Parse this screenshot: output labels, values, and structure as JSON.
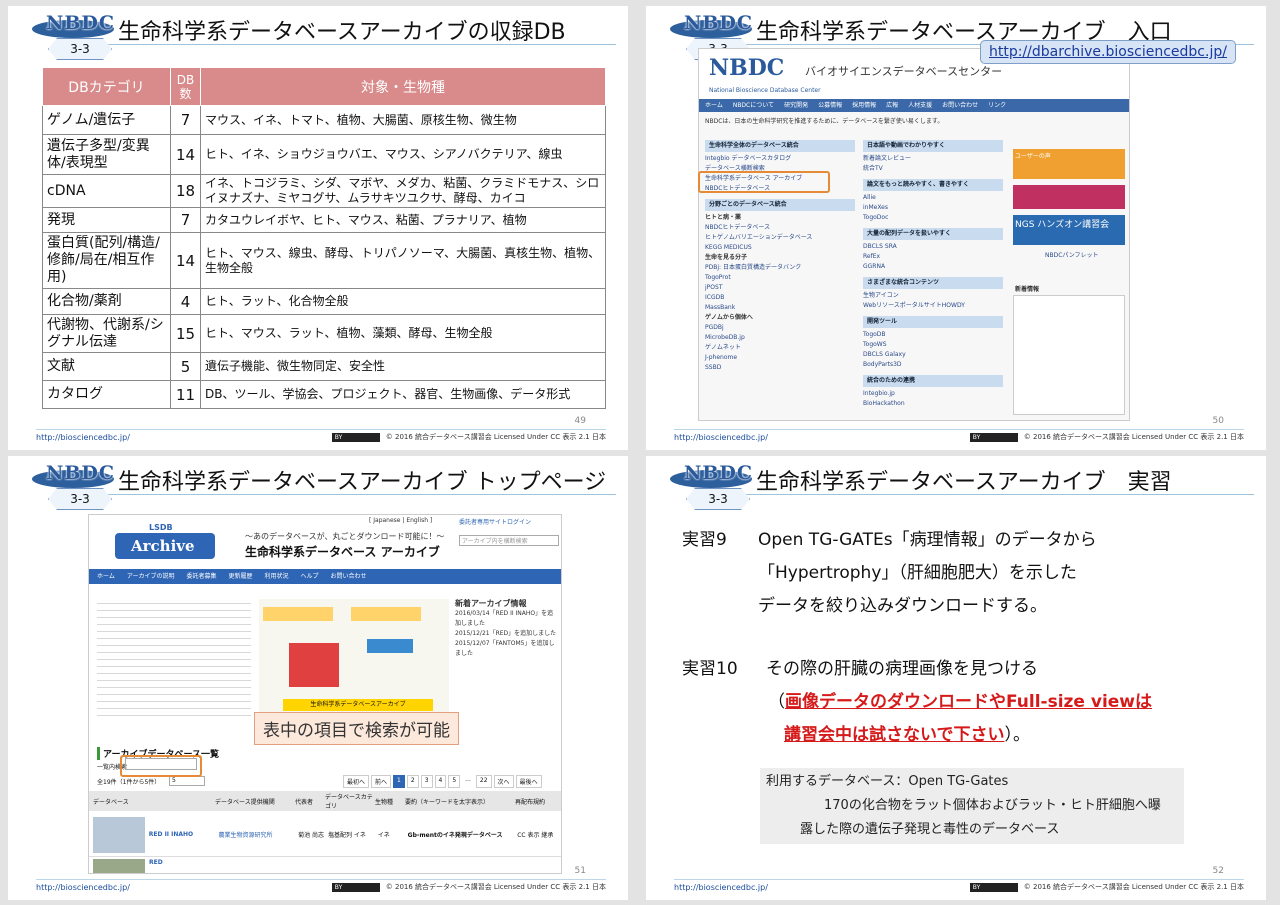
{
  "brand": "NBDC",
  "badge": "3-3",
  "footer_url": "http://biosciencedbc.jp/",
  "cc_label": "BY",
  "copyright": "© 2016 統合データベース講習会 Licensed Under CC 表示 2.1 日本",
  "s49": {
    "title": "生命科学系データベースアーカイブの収録DB",
    "page": "49",
    "headers": [
      "DBカテゴリ",
      "DB数",
      "対象・生物種"
    ],
    "rows": [
      {
        "cat": "ゲノム/遺伝子",
        "n": "7",
        "target": "マウス、イネ、トマト、植物、大腸菌、原核生物、微生物"
      },
      {
        "cat": "遺伝子多型/変異体/表現型",
        "n": "14",
        "target": "ヒト、イネ、ショウジョウバエ、マウス、シアノバクテリア、線虫"
      },
      {
        "cat": "cDNA",
        "n": "18",
        "target": "イネ、トコジラミ、シダ、マボヤ、メダカ、粘菌、クラミドモナス、シロイヌナズナ、ミヤコグサ、ムラサキツユクサ、酵母、カイコ"
      },
      {
        "cat": "発現",
        "n": "7",
        "target": "カタユウレイボヤ、ヒト、マウス、粘菌、プラナリア、植物"
      },
      {
        "cat": "蛋白質(配列/構造/修飾/局在/相互作用)",
        "n": "14",
        "target": "ヒト、マウス、線虫、酵母、トリパノソーマ、大腸菌、真核生物、植物、生物全般"
      },
      {
        "cat": "化合物/薬剤",
        "n": "4",
        "target": "ヒト、ラット、化合物全般"
      },
      {
        "cat": "代謝物、代謝系/シグナル伝達",
        "n": "15",
        "target": "ヒト、マウス、ラット、植物、藻類、酵母、生物全般"
      },
      {
        "cat": "文献",
        "n": "5",
        "target": "遺伝子機能、微生物同定、安全性"
      },
      {
        "cat": "カタログ",
        "n": "11",
        "target": "DB、ツール、学協会、プロジェクト、器官、生物画像、データ形式"
      }
    ]
  },
  "s50": {
    "title": "生命科学系データベースアーカイブ　入口",
    "page": "50",
    "url": "http://dbarchive.biosciencedbc.jp/",
    "site_name": "バイオサイエンスデータベースセンター",
    "site_en": "National Bioscience Database Center",
    "nav": [
      "ホーム",
      "NBDCについて",
      "研究開発",
      "公募情報",
      "採用情報",
      "広報",
      "人材支援",
      "お問い合わせ",
      "リンク"
    ],
    "intro": "NBDCは、日本の生命科学研究を推進するために、データベースを繋ぎ使い易くします。",
    "left_box": "生命科学全体のデータベース統合",
    "left_links": [
      "Integbio データベースカタログ",
      "データベース横断検索",
      "生命科学系データベース アーカイブ",
      "NBDCヒトデータベース"
    ],
    "field_box": "分野ごとのデータベース統合",
    "field_links": [
      "ヒトと病・薬",
      "NBDCヒトデータベース",
      "ヒトゲノムバリエーションデータベース",
      "KEGG MEDICUS",
      "生命を見る分子",
      "PDBj: 日本蛋白質構造データバンク",
      "TogoProt",
      "jPOST",
      "ICGDB",
      "MassBank",
      "ゲノムから個体へ",
      "PGDBj",
      "MicrobeDB.jp",
      "ゲノムネット",
      "J-phenome",
      "SSBD"
    ],
    "right1": "日本語や動画でわかりやすく",
    "right1_links": [
      "新着論文レビュー",
      "統合TV"
    ],
    "right2": "論文をもっと読みやすく、書きやすく",
    "right2_links": [
      "Allie",
      "inMeXes",
      "TogoDoc"
    ],
    "right3": "大量の配列データを扱いやすく",
    "right3_links": [
      "DBCLS SRA",
      "RefEx",
      "GGRNA"
    ],
    "right4": "さまざまな統合コンテンツ",
    "right4_links": [
      "生物アイコン",
      "WebリソースポータルサイトHOWDY"
    ],
    "right5": "開発ツール",
    "right5_links": [
      "TogoDB",
      "TogoWS",
      "DBCLS Galaxy",
      "BodyParts3D"
    ],
    "right6": "統合のための連携",
    "right6_links": [
      "Integbio.jp",
      "BioHackathon"
    ],
    "ads": [
      "ユーザーの声",
      "NGS ハンズオン講習会",
      "NBDCパンフレット"
    ],
    "news_title": "新着情報"
  },
  "s51": {
    "title": "生命科学系データベースアーカイブ トップページ",
    "page": "51",
    "site_title": "生命科学系データベース アーカイブ",
    "site_logo": "Archive",
    "site_tag": "LSDB",
    "lang": "[ Japanese | English ]",
    "login": "委託者専用サイトログイン",
    "headline": "～あのデータベースが、丸ごとダウンロード可能に！～",
    "search_placeholder": "アーカイブ内を横断検索",
    "nav": [
      "ホーム",
      "アーカイブの説明",
      "委託者募集",
      "更新履歴",
      "利用状況",
      "ヘルプ",
      "お問い合わせ"
    ],
    "news_head": "新着アーカイブ情報",
    "news": [
      "2016/03/14「RED II INAHO」を追加しました",
      "2015/12/21「RED」を追加しました",
      "2015/12/07「FANTOM5」を追加しました"
    ],
    "flow_center": "生命科学系データベースアーカイブ",
    "callout": "表中の項目で検索が可能",
    "list_head": "アーカイブデータベース一覧",
    "filter_label": "一覧内検索",
    "count": "全19件（1件から5件）",
    "per_page": "5",
    "pager": [
      "最初へ",
      "前へ",
      "1",
      "2",
      "3",
      "4",
      "5",
      "...",
      "22",
      "次へ",
      "最後へ"
    ],
    "cols": [
      "データベース",
      "データベース提供機関",
      "代表者",
      "データベースカテゴリ",
      "生物種",
      "要約（キーワードを太字表示）",
      "再配布規約"
    ],
    "row1": {
      "name": "RED II INAHO",
      "org": "農業生物資源研究所",
      "rep": "菊池 尚志",
      "cat": "塩基配列 イネ",
      "sp": "イネ",
      "sum": "Gb-mentのイネ発現データベース",
      "lic": "CC 表示 継承"
    },
    "row2": {
      "name": "RED"
    }
  },
  "s52": {
    "title": "生命科学系データベースアーカイブ　実習",
    "page": "52",
    "ex9_label": "実習9",
    "ex9_l1": "Open TG-GATEs「病理情報」のデータから",
    "ex9_l2": "「Hypertrophy」（肝細胞肥大）を示した",
    "ex9_l3": "データを絞り込みダウンロードする。",
    "ex10_label": "実習10",
    "ex10_l1": "その際の肝臓の病理画像を見つける",
    "warn_open": "（",
    "warn1": "画像データのダウンロードやFull-size viewは",
    "warn2": "講習会中は試さないで下さい",
    "warn_close": "）。",
    "note_l1": "利用するデータベース：Open TG-Gates",
    "note_l2": "170の化合物をラット個体およびラット・ヒト肝細胞へ曝",
    "note_l3": "露した際の遺伝子発現と毒性のデータベース"
  }
}
